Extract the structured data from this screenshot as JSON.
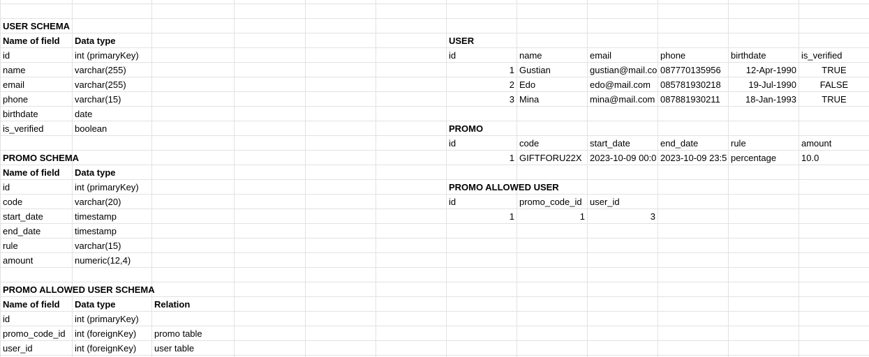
{
  "user_schema": {
    "title": "USER SCHEMA",
    "headers": [
      "Name of field",
      "Data type"
    ],
    "rows": [
      [
        "id",
        "int (primaryKey)"
      ],
      [
        "name",
        "varchar(255)"
      ],
      [
        "email",
        "varchar(255)"
      ],
      [
        "phone",
        "varchar(15)"
      ],
      [
        "birthdate",
        "date"
      ],
      [
        "is_verified",
        "boolean"
      ]
    ]
  },
  "promo_schema": {
    "title": "PROMO SCHEMA",
    "headers": [
      "Name of field",
      "Data type"
    ],
    "rows": [
      [
        "id",
        "int (primaryKey)"
      ],
      [
        "code",
        "varchar(20)"
      ],
      [
        "start_date",
        "timestamp"
      ],
      [
        "end_date",
        "timestamp"
      ],
      [
        "rule",
        "varchar(15)"
      ],
      [
        "amount",
        "numeric(12,4)"
      ]
    ]
  },
  "promo_allowed_user_schema": {
    "title": "PROMO ALLOWED USER SCHEMA",
    "headers": [
      "Name of field",
      "Data type",
      "Relation"
    ],
    "rows": [
      [
        "id",
        "int (primaryKey)",
        ""
      ],
      [
        "promo_code_id",
        "int (foreignKey)",
        "promo table"
      ],
      [
        "user_id",
        "int (foreignKey)",
        "user table"
      ]
    ]
  },
  "user_table": {
    "title": "USER",
    "headers": [
      "id",
      "name",
      "email",
      "phone",
      "birthdate",
      "is_verified"
    ],
    "rows": [
      [
        "1",
        "Gustian",
        "gustian@mail.co",
        "087770135956",
        "12-Apr-1990",
        "TRUE"
      ],
      [
        "2",
        "Edo",
        "edo@mail.com",
        "085781930218",
        "19-Jul-1990",
        "FALSE"
      ],
      [
        "3",
        "Mina",
        "mina@mail.com",
        "087881930211",
        "18-Jan-1993",
        "TRUE"
      ]
    ]
  },
  "promo_table": {
    "title": "PROMO",
    "headers": [
      "id",
      "code",
      "start_date",
      "end_date",
      "rule",
      "amount"
    ],
    "rows": [
      [
        "1",
        "GIFTFORU22X",
        "2023-10-09 00:0",
        "2023-10-09 23:5",
        "percentage",
        "10.0"
      ]
    ]
  },
  "promo_allowed_user_table": {
    "title": "PROMO ALLOWED USER",
    "headers": [
      "id",
      "promo_code_id",
      "user_id"
    ],
    "rows": [
      [
        "1",
        "1",
        "3"
      ]
    ]
  }
}
